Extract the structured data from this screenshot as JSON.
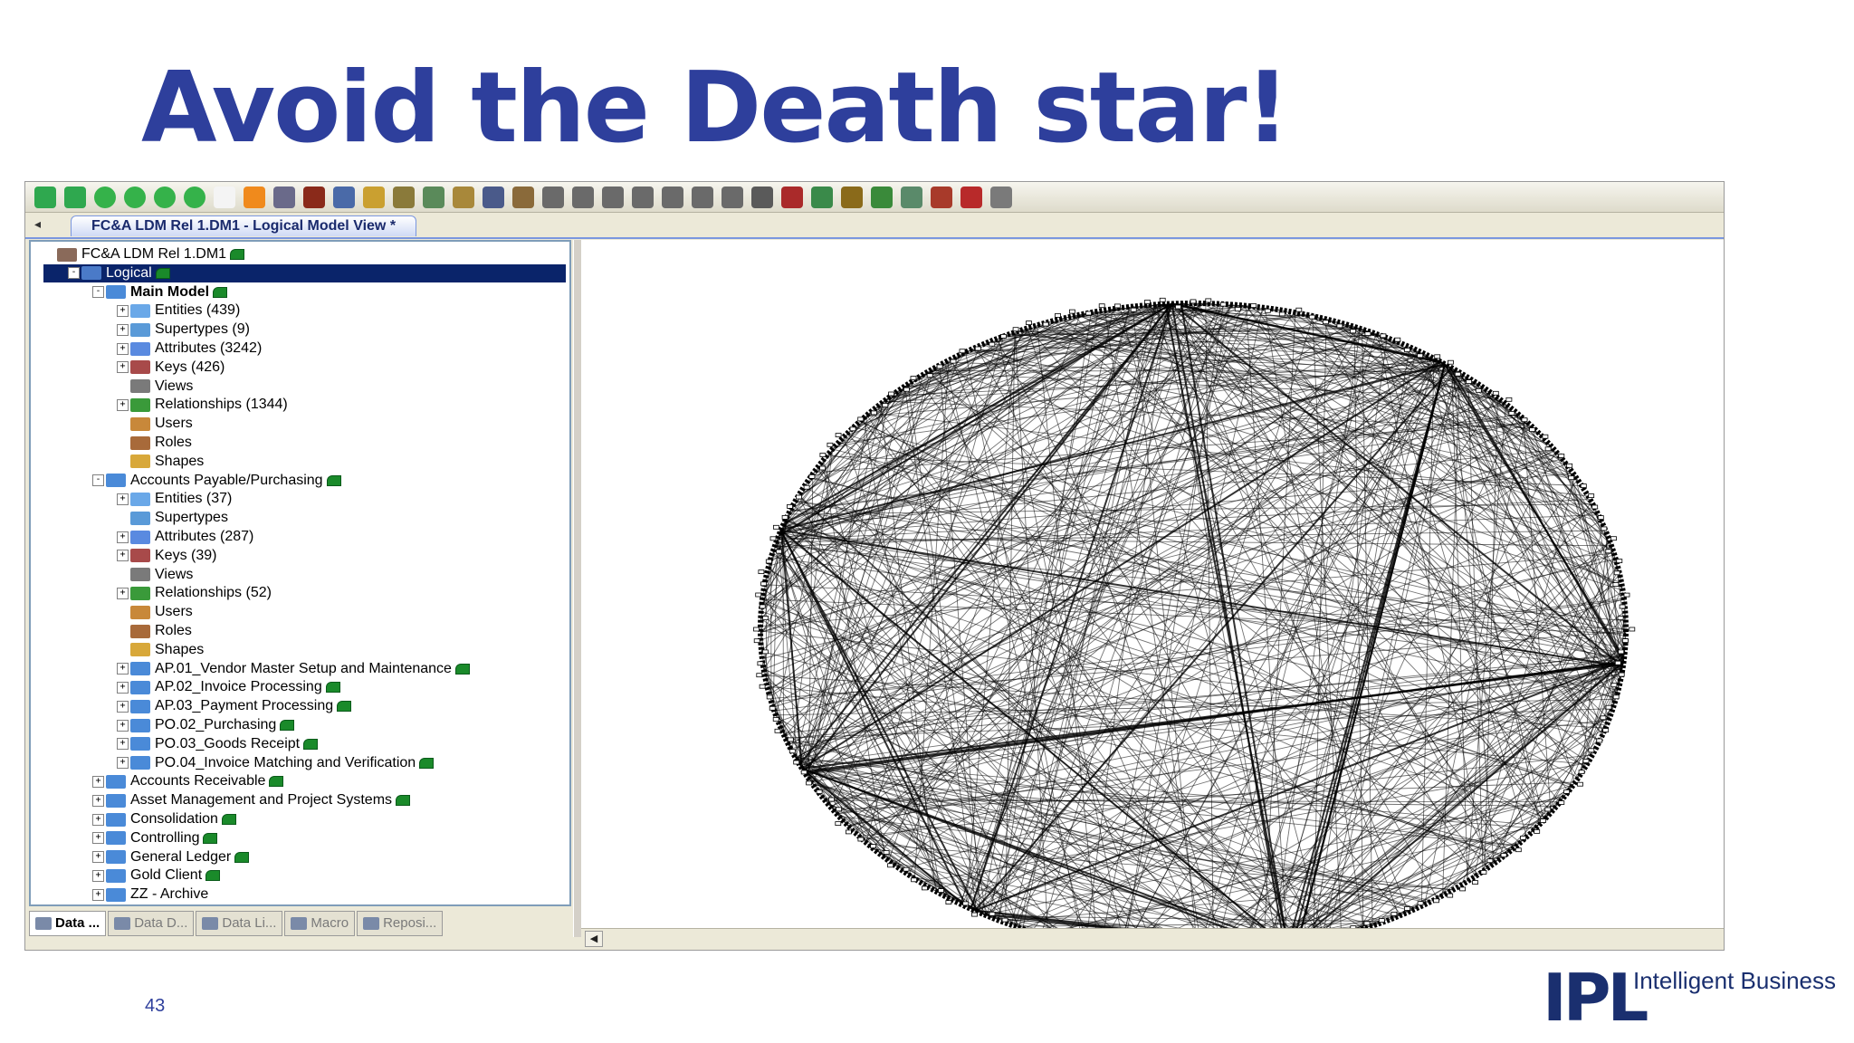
{
  "slide": {
    "title": "Avoid the Death star!",
    "page_number": "43",
    "logo_text": "IPL",
    "tagline": "Intelligent Business"
  },
  "app": {
    "document_tab": "FC&A LDM Rel 1.DM1 - Logical Model View *",
    "toolbar_icons": [
      "entity-icon",
      "view-icon",
      "circle-icon",
      "circle-icon",
      "circle-icon",
      "circle-icon",
      "page-icon",
      "arrow-icon",
      "text-box-icon",
      "text-icon",
      "select-icon",
      "relationship-icon",
      "subtype-icon",
      "link-icon",
      "key-icon",
      "zoom-icon",
      "layout-icon",
      "align-left-icon",
      "align-top-icon",
      "align-right-icon",
      "align-bottom-icon",
      "center-icon",
      "distribute-icon",
      "grid-icon",
      "report-icon",
      "compare-icon",
      "export-icon",
      "merge-icon",
      "macro-icon",
      "repository-icon",
      "settings-icon",
      "close-icon",
      "help-icon"
    ],
    "tree": [
      {
        "label": "FC&A LDM Rel 1.DM1",
        "level": 0,
        "icon": "model-file-icon",
        "lock": true
      },
      {
        "label": "Logical",
        "level": 1,
        "icon": "logical-model-icon",
        "lock": true,
        "selected": true,
        "expander": "-"
      },
      {
        "label": "Main Model",
        "level": 2,
        "icon": "submodel-icon",
        "lock": true,
        "bold": true,
        "expander": "-"
      },
      {
        "label": "Entities (439)",
        "level": 3,
        "icon": "entities-icon",
        "expander": "+"
      },
      {
        "label": "Supertypes (9)",
        "level": 3,
        "icon": "supertypes-icon",
        "expander": "+"
      },
      {
        "label": "Attributes (3242)",
        "level": 3,
        "icon": "attributes-icon",
        "expander": "+"
      },
      {
        "label": "Keys (426)",
        "level": 3,
        "icon": "keys-icon",
        "expander": "+"
      },
      {
        "label": "Views",
        "level": 3,
        "icon": "views-icon"
      },
      {
        "label": "Relationships (1344)",
        "level": 3,
        "icon": "relationships-icon",
        "expander": "+"
      },
      {
        "label": "Users",
        "level": 3,
        "icon": "users-icon"
      },
      {
        "label": "Roles",
        "level": 3,
        "icon": "roles-icon"
      },
      {
        "label": "Shapes",
        "level": 3,
        "icon": "shapes-icon"
      },
      {
        "label": "Accounts Payable/Purchasing",
        "level": 2,
        "icon": "submodel-icon",
        "lock": true,
        "expander": "-"
      },
      {
        "label": "Entities (37)",
        "level": 3,
        "icon": "entities-icon",
        "expander": "+"
      },
      {
        "label": "Supertypes",
        "level": 3,
        "icon": "supertypes-icon"
      },
      {
        "label": "Attributes (287)",
        "level": 3,
        "icon": "attributes-icon",
        "expander": "+"
      },
      {
        "label": "Keys (39)",
        "level": 3,
        "icon": "keys-icon",
        "expander": "+"
      },
      {
        "label": "Views",
        "level": 3,
        "icon": "views-icon"
      },
      {
        "label": "Relationships (52)",
        "level": 3,
        "icon": "relationships-icon",
        "expander": "+"
      },
      {
        "label": "Users",
        "level": 3,
        "icon": "users-icon"
      },
      {
        "label": "Roles",
        "level": 3,
        "icon": "roles-icon"
      },
      {
        "label": "Shapes",
        "level": 3,
        "icon": "shapes-icon"
      },
      {
        "label": "AP.01_Vendor Master Setup and Maintenance",
        "level": 3,
        "icon": "submodel-icon",
        "lock": true,
        "expander": "+"
      },
      {
        "label": "AP.02_Invoice Processing",
        "level": 3,
        "icon": "submodel-icon",
        "lock": true,
        "expander": "+"
      },
      {
        "label": "AP.03_Payment Processing",
        "level": 3,
        "icon": "submodel-icon",
        "lock": true,
        "expander": "+"
      },
      {
        "label": "PO.02_Purchasing",
        "level": 3,
        "icon": "submodel-icon",
        "lock": true,
        "expander": "+"
      },
      {
        "label": "PO.03_Goods Receipt",
        "level": 3,
        "icon": "submodel-icon",
        "lock": true,
        "expander": "+"
      },
      {
        "label": "PO.04_Invoice Matching and Verification",
        "level": 3,
        "icon": "submodel-icon",
        "lock": true,
        "expander": "+"
      },
      {
        "label": "Accounts Receivable",
        "level": 2,
        "icon": "submodel-icon",
        "lock": true,
        "expander": "+"
      },
      {
        "label": "Asset Management and Project Systems",
        "level": 2,
        "icon": "submodel-icon",
        "lock": true,
        "expander": "+"
      },
      {
        "label": "Consolidation",
        "level": 2,
        "icon": "submodel-icon",
        "lock": true,
        "expander": "+"
      },
      {
        "label": "Controlling",
        "level": 2,
        "icon": "submodel-icon",
        "lock": true,
        "expander": "+"
      },
      {
        "label": "General Ledger",
        "level": 2,
        "icon": "submodel-icon",
        "lock": true,
        "expander": "+"
      },
      {
        "label": "Gold Client",
        "level": 2,
        "icon": "submodel-icon",
        "lock": true,
        "expander": "+"
      },
      {
        "label": "ZZ - Archive",
        "level": 2,
        "icon": "submodel-icon",
        "expander": "+"
      }
    ],
    "bottom_tabs": [
      {
        "label": "Data ...",
        "active": true
      },
      {
        "label": "Data D...",
        "active": false
      },
      {
        "label": "Data Li...",
        "active": false
      },
      {
        "label": "Macro",
        "active": false
      },
      {
        "label": "Reposi...",
        "active": false
      }
    ]
  }
}
